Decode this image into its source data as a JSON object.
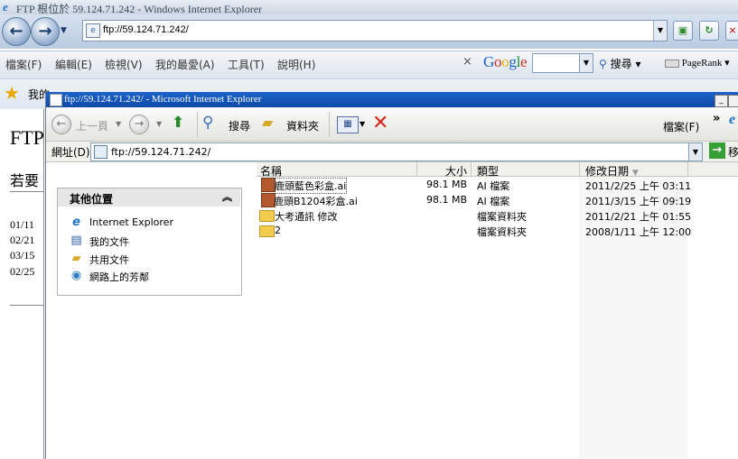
{
  "outer": {
    "title": "FTP 根位於 59.124.71.242 - Windows Internet Explorer",
    "address": "ftp://59.124.71.242/",
    "menu": [
      "檔案(F)",
      "編輯(E)",
      "檢視(V)",
      "我的最愛(A)",
      "工具(T)",
      "說明(H)"
    ],
    "google": {
      "close": "×",
      "logo": "Google",
      "search_label": "搜尋",
      "pagerank": "PageRank"
    },
    "favorites_label": "我的",
    "background_page": {
      "heading": "FTP",
      "line2": "若要",
      "dates": [
        "01/11",
        "02/21",
        "03/15",
        "02/25"
      ]
    }
  },
  "inner": {
    "title": "ftp://59.124.71.242/ - Microsoft Internet Explorer",
    "toolbar": {
      "back_label": "上一頁",
      "search_label": "搜尋",
      "folders_label": "資料夾",
      "file_menu": "檔案(F)",
      "chevron": "»"
    },
    "address_label": "網址(D)",
    "address": "ftp://59.124.71.242/",
    "go_label": "移",
    "other_places": {
      "title": "其他位置",
      "items": [
        {
          "label": "Internet Explorer",
          "icon": "internet-explorer-icon"
        },
        {
          "label": "我的文件",
          "icon": "my-documents-icon"
        },
        {
          "label": "共用文件",
          "icon": "shared-documents-icon"
        },
        {
          "label": "網路上的芳鄰",
          "icon": "network-places-icon"
        }
      ]
    },
    "columns": {
      "name": "名稱",
      "size": "大小",
      "type": "類型",
      "modified": "修改日期"
    },
    "files": [
      {
        "name": "鹿頭藍色彩盒.ai",
        "size": "98.1 MB",
        "type": "AI 檔案",
        "modified": "2011/2/25 上午 03:11",
        "icon": "ai-file-icon"
      },
      {
        "name": "鹿頭B1204彩盒.ai",
        "size": "98.1 MB",
        "type": "AI 檔案",
        "modified": "2011/3/15 上午 09:19",
        "icon": "ai-file-icon"
      },
      {
        "name": "大考通訊 修改",
        "size": "",
        "type": "檔案資料夾",
        "modified": "2011/2/21 上午 01:55",
        "icon": "folder-icon"
      },
      {
        "name": "2",
        "size": "",
        "type": "檔案資料夾",
        "modified": "2008/1/11 上午 12:00",
        "icon": "folder-icon"
      }
    ]
  }
}
